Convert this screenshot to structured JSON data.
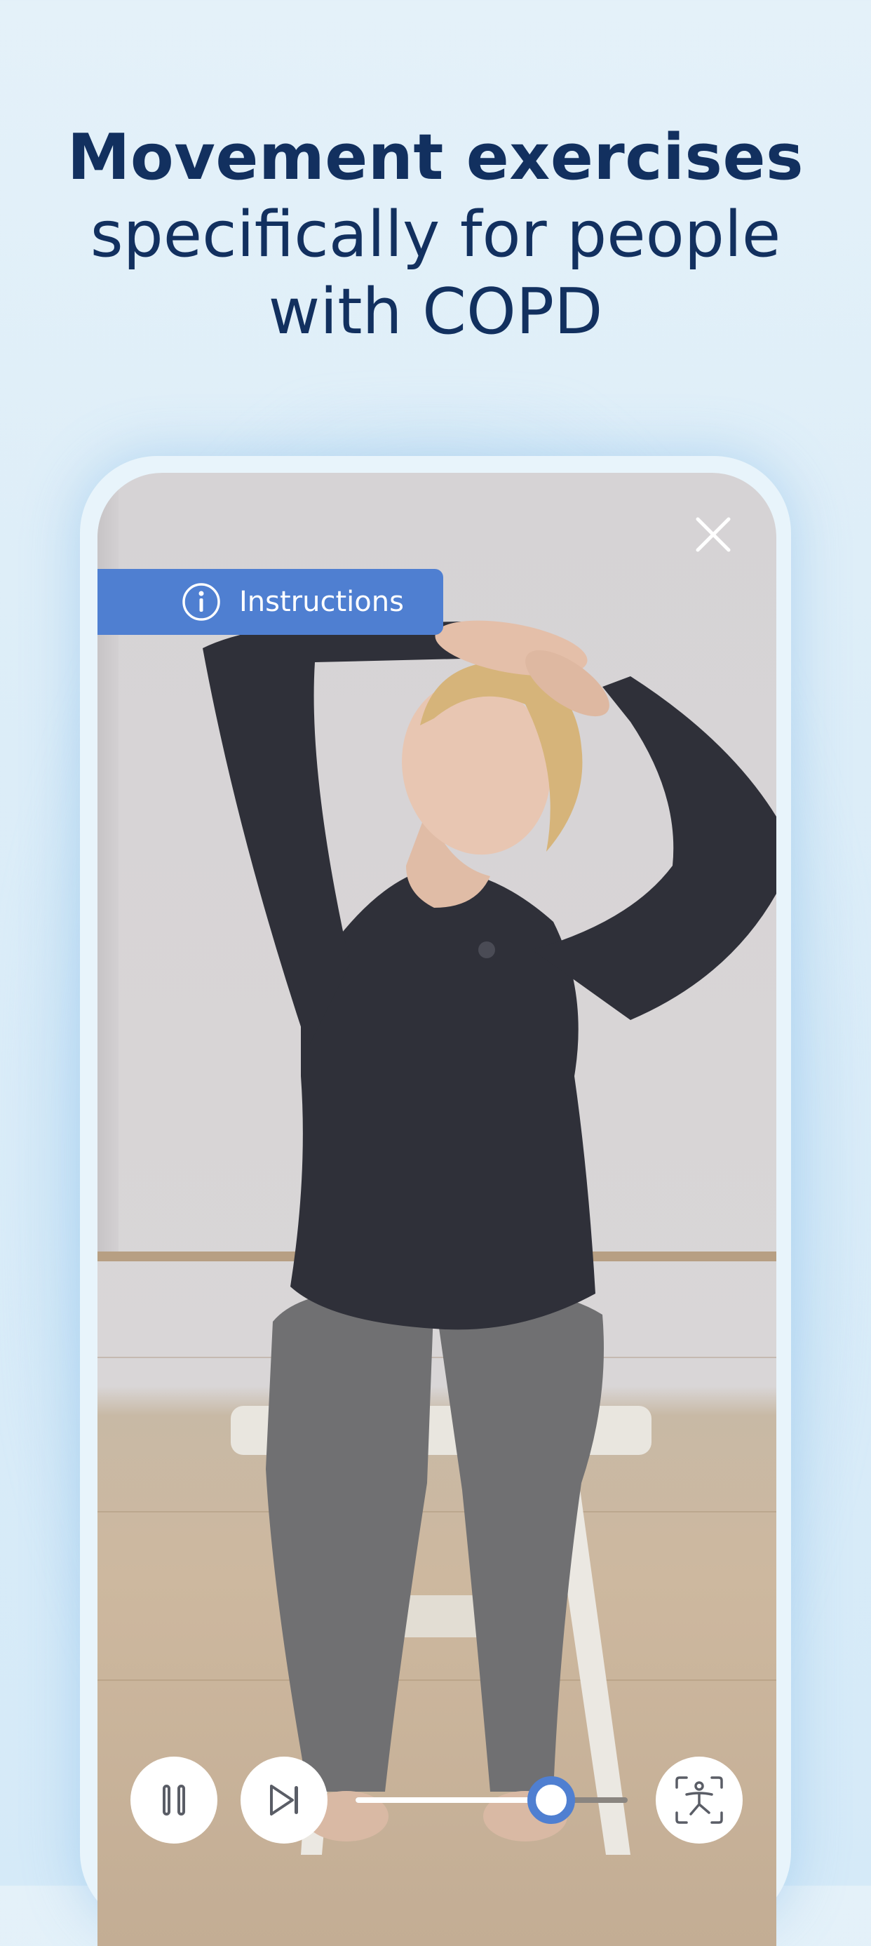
{
  "headline": {
    "bold": "Movement exercises",
    "line2": "specifically for people",
    "line3": "with COPD"
  },
  "player": {
    "instructions_label": "Instructions",
    "close_icon": "close-icon",
    "info_icon": "info-icon",
    "pause_icon": "pause-icon",
    "skip_icon": "skip-next-icon",
    "exercise_icon": "exercise-body-icon",
    "progress": 0.72
  },
  "colors": {
    "accent": "#4f7fd1",
    "headline": "#12305f",
    "background": "#e4f1f9"
  }
}
